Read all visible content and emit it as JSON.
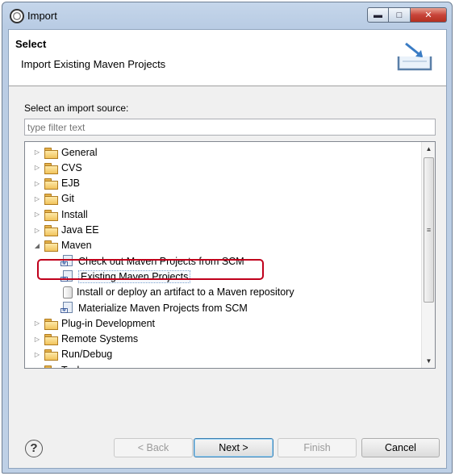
{
  "window": {
    "title": "Import"
  },
  "header": {
    "title": "Select",
    "description": "Import Existing Maven Projects"
  },
  "source": {
    "label": "Select an import source:",
    "filter_placeholder": "type filter text"
  },
  "tree": {
    "items": [
      {
        "label": "General",
        "type": "folder",
        "expanded": false
      },
      {
        "label": "CVS",
        "type": "folder",
        "expanded": false
      },
      {
        "label": "EJB",
        "type": "folder",
        "expanded": false
      },
      {
        "label": "Git",
        "type": "folder",
        "expanded": false
      },
      {
        "label": "Install",
        "type": "folder",
        "expanded": false
      },
      {
        "label": "Java EE",
        "type": "folder",
        "expanded": false
      },
      {
        "label": "Maven",
        "type": "folder",
        "expanded": true
      },
      {
        "label": "Check out Maven Projects from SCM",
        "type": "maven-item"
      },
      {
        "label": "Existing Maven Projects",
        "type": "maven-item",
        "selected": true
      },
      {
        "label": "Install or deploy an artifact to a Maven repository",
        "type": "jar-item"
      },
      {
        "label": "Materialize Maven Projects from SCM",
        "type": "maven-item"
      },
      {
        "label": "Plug-in Development",
        "type": "folder",
        "expanded": false
      },
      {
        "label": "Remote Systems",
        "type": "folder",
        "expanded": false
      },
      {
        "label": "Run/Debug",
        "type": "folder",
        "expanded": false
      },
      {
        "label": "Tasks",
        "type": "folder",
        "expanded": false
      }
    ]
  },
  "buttons": {
    "back": "< Back",
    "next": "Next >",
    "finish": "Finish",
    "cancel": "Cancel"
  },
  "colors": {
    "highlight": "#c0001c",
    "title_gradient": "#c5d6ea"
  }
}
